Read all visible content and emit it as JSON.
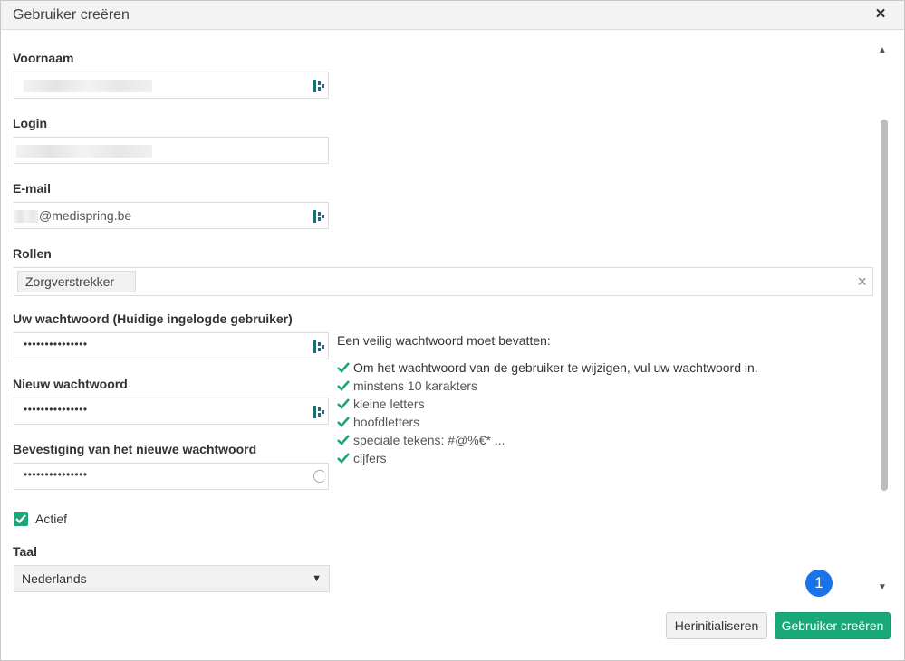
{
  "dialog": {
    "title": "Gebruiker creëren",
    "close_label": "×"
  },
  "form": {
    "first_name": {
      "label": "Voornaam",
      "value": ""
    },
    "login": {
      "label": "Login",
      "value": ""
    },
    "email": {
      "label": "E-mail",
      "value": "@medispring.be"
    },
    "roles": {
      "label": "Rollen",
      "selected": [
        "Zorgverstrekker"
      ],
      "clear_label": "×"
    },
    "current_password": {
      "label": "Uw wachtwoord (Huidige ingelogde gebruiker)",
      "value": "•••••••••••••••"
    },
    "new_password": {
      "label": "Nieuw wachtwoord",
      "value": "•••••••••••••••"
    },
    "confirm_password": {
      "label": "Bevestiging van het nieuwe wachtwoord",
      "value": "•••••••••••••••"
    },
    "active": {
      "label": "Actief",
      "checked": true
    },
    "language": {
      "label": "Taal",
      "value": "Nederlands"
    }
  },
  "password_help": {
    "title": "Een veilig wachtwoord moet bevatten:",
    "rules": [
      "Om het wachtwoord van de gebruiker te wijzigen, vul uw wachtwoord in.",
      "minstens 10 karakters",
      "kleine letters",
      "hoofdletters",
      "speciale tekens: #@%€* ...",
      "cijfers"
    ],
    "check_color": "#1ea57a"
  },
  "notification_badge": "1",
  "buttons": {
    "reset": "Herinitialiseren",
    "create": "Gebruiker creëren"
  },
  "colors": {
    "primary": "#19a977",
    "badge": "#1a73e8",
    "extension_icon": "#1b6e78"
  }
}
